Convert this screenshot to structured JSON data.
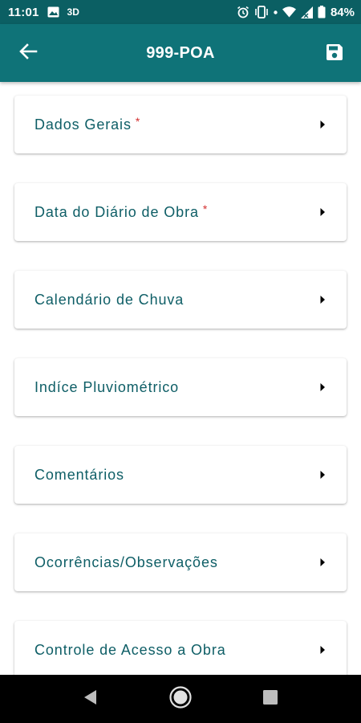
{
  "status_bar": {
    "time": "11:01",
    "indicator": "3D",
    "battery": "84%"
  },
  "app_bar": {
    "title": "999-POA"
  },
  "menu": {
    "items": [
      {
        "label": "Dados Gerais",
        "required": "*"
      },
      {
        "label": "Data do Diário de Obra",
        "required": "*"
      },
      {
        "label": "Calendário de Chuva",
        "required": ""
      },
      {
        "label": "Indíce Pluviométrico",
        "required": ""
      },
      {
        "label": "Comentários",
        "required": ""
      },
      {
        "label": "Ocorrências/Observações",
        "required": ""
      },
      {
        "label": "Controle de Acesso a Obra",
        "required": ""
      }
    ]
  },
  "icons": {
    "back": "arrow-back-icon",
    "save": "save-icon",
    "item_arrow": "arrow-right-icon",
    "nav_back": "triangle-back-icon",
    "nav_home": "circle-home-icon",
    "nav_recents": "square-recents-icon"
  },
  "colors": {
    "status_bar": "#0b5f63",
    "app_bar": "#0f7378",
    "label_text": "#0e5e66",
    "required_mark": "#d32f2f",
    "nav_bar": "#000000"
  }
}
